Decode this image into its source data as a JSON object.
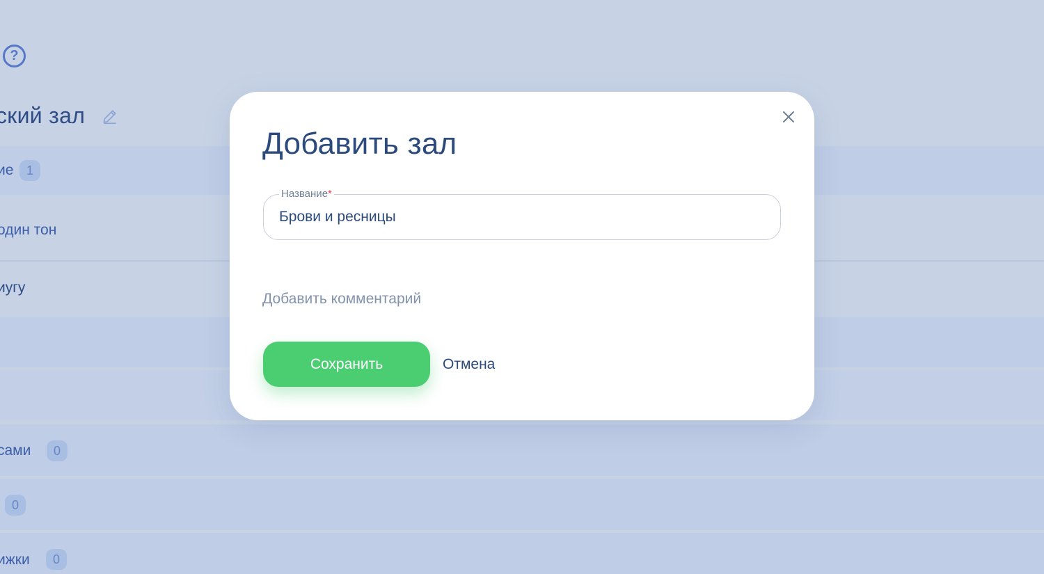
{
  "background": {
    "help_glyph": "?",
    "title": "ский зал",
    "rows": [
      {
        "label": "ие",
        "badge": "1"
      },
      {
        "label": "один тон"
      },
      {
        "label": "иугу"
      },
      {
        "label": "сами",
        "badge": "0"
      },
      {
        "label": "",
        "badge": "0"
      },
      {
        "label": "ижки",
        "badge": "0"
      }
    ]
  },
  "modal": {
    "title": "Добавить зал",
    "close_icon": "close-icon",
    "name_field": {
      "label": "Название",
      "required_mark": "*",
      "value": "Брови и ресницы"
    },
    "add_comment_label": "Добавить комментарий",
    "save_label": "Сохранить",
    "cancel_label": "Отмена"
  },
  "colors": {
    "overlay": "#c7d3e5",
    "title": "#2c4b7c",
    "accent_green": "#4bcd72",
    "muted_link": "#8293ab",
    "required": "#e5484d"
  }
}
